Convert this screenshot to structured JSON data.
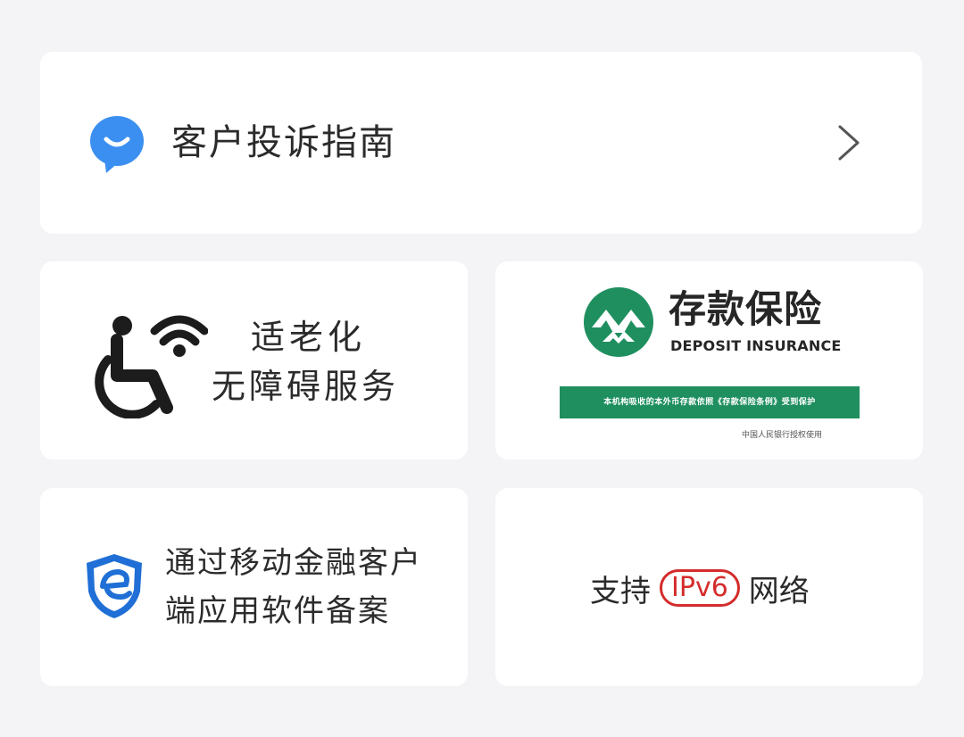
{
  "complaint": {
    "label": "客户投诉指南",
    "icon": "chat-smile-icon",
    "chevron": "chevron-right-icon"
  },
  "accessibility": {
    "line1": "适老化",
    "line2": "无障碍服务",
    "icon": "wheelchair-wifi-icon"
  },
  "deposit_insurance": {
    "title_cn": "存款保险",
    "title_en": "DEPOSIT INSURANCE",
    "banner": "本机构吸收的本外币存款依照《存款保险条例》受到保护",
    "note": "中国人民银行授权使用",
    "brand_color": "#1f8f5f"
  },
  "filing": {
    "line1": "通过移动金融客户",
    "line2": "端应用软件备案",
    "icon": "shield-e-icon"
  },
  "ipv6": {
    "prefix": "支持",
    "badge": "IPv6",
    "suffix": "网络",
    "accent": "#d42c2c"
  }
}
